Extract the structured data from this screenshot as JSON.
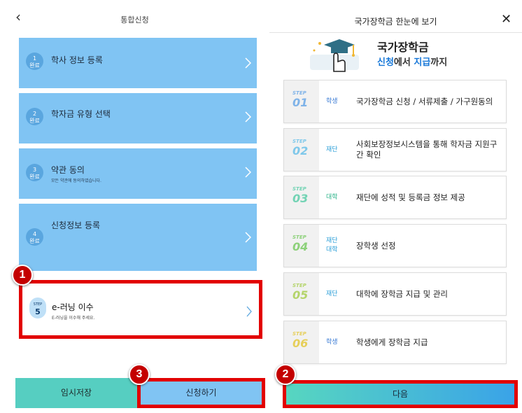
{
  "left": {
    "back_icon": "chevron-left-icon",
    "title": "통합신청",
    "steps": [
      {
        "num": "1",
        "status": "완료",
        "label": "학사 정보 등록",
        "sub": ""
      },
      {
        "num": "2",
        "status": "완료",
        "label": "학자금 유형 선택",
        "sub": ""
      },
      {
        "num": "3",
        "status": "완료",
        "label": "약관 동의",
        "sub": "모든 약관에 동의하였습니다."
      },
      {
        "num": "4",
        "status": "완료",
        "label": "신청정보 등록",
        "sub": ""
      }
    ],
    "current_step": {
      "badge_top": "STEP",
      "badge_num": "5",
      "label": "e-러닝 이수",
      "sub": "E-러닝을 이수해 주세요."
    },
    "temp_save_label": "임시저장",
    "apply_label": "신청하기"
  },
  "right": {
    "title": "국가장학금 한눈에 보기",
    "close_icon": "close-icon",
    "hero_icon": "graduation-cap-hand-icon",
    "hero_title": "국가장학금",
    "hero_sub_1": "신청",
    "hero_sub_2": "에서 ",
    "hero_sub_3": "지급",
    "hero_sub_4": "까지",
    "step_word": "STEP",
    "steps": [
      {
        "num": "01",
        "who": "학생",
        "desc": "국가장학금 신청 / 서류제출 / 가구원동의",
        "color": "#7fb3e8",
        "who_color": "#3a7bd5"
      },
      {
        "num": "02",
        "who": "재단",
        "desc": "사회보장정보시스템을 통해 학자금 지원구간 확인",
        "color": "#7fc8ea",
        "who_color": "#2c9fd8"
      },
      {
        "num": "03",
        "who": "대학",
        "desc": "재단에 성적 및 등록금 정보 제공",
        "color": "#72d3b4",
        "who_color": "#2ab389"
      },
      {
        "num": "04",
        "who": "재단\n대학",
        "desc": "장학생 선정",
        "color": "#8dd17a",
        "who_color": "#2c9fd8"
      },
      {
        "num": "05",
        "who": "재단",
        "desc": "대학에 장학금 지급 및 관리",
        "color": "#b4d46a",
        "who_color": "#2c9fd8"
      },
      {
        "num": "06",
        "who": "학생",
        "desc": "학생에게 장학금 지급",
        "color": "#e6cf5a",
        "who_color": "#3a7bd5"
      }
    ],
    "next_label": "다음"
  },
  "markers": [
    "1",
    "2",
    "3"
  ],
  "colors": {
    "card": "#80c4f3",
    "highlight": "#e20000",
    "teal": "#56cec1",
    "marker": "#c40000"
  }
}
